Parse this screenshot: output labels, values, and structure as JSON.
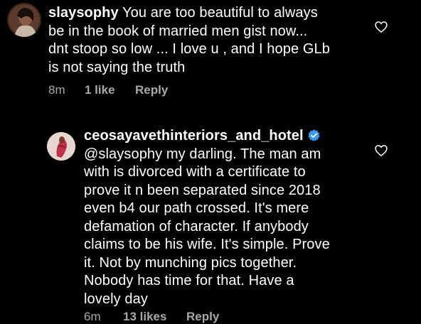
{
  "comments": [
    {
      "username": "slaysophy",
      "verified": false,
      "lines": [
        " You are too beautiful to always",
        "be in the book of married men gist now...",
        "dnt stoop so low ... I love u , and I hope GLb",
        "is not saying the truth"
      ],
      "time": "8m",
      "likes": "1 like",
      "reply": "Reply"
    },
    {
      "username": "ceosayavethinteriors_and_hotel",
      "verified": true,
      "lines": [
        "@slaysophy my darling. The man am",
        "with is divorced with a certificate to",
        "prove it n been separated since 2018",
        "even b4 our path crossed.  It's mere",
        "defamation of character. If anybody",
        "claims to be his wife. It's simple. Prove",
        "it. Not by munching pics together.",
        "Nobody has time for that.  Have a",
        "lovely day"
      ],
      "time": "6m",
      "likes": "13 likes",
      "reply": "Reply"
    }
  ],
  "colors": {
    "background": "#000000",
    "text": "#ffffff",
    "meta": "#a8a8a8",
    "verified_badge": "#3897f0"
  },
  "icons": {
    "like": "heart-outline-icon",
    "verified": "verified-badge-icon"
  }
}
